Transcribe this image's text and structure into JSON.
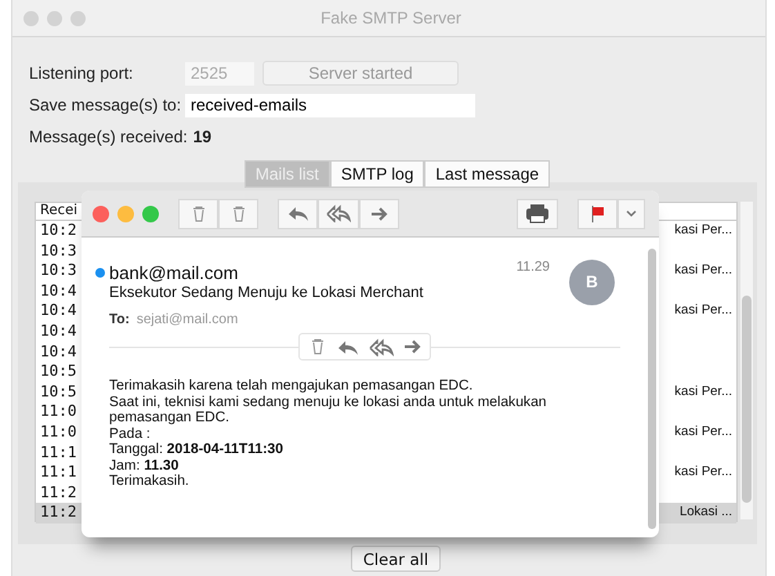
{
  "window": {
    "title": "Fake SMTP Server"
  },
  "form": {
    "port_label": "Listening port:",
    "port_value": "2525",
    "server_button": {
      "label": "Server started",
      "disabled": true
    },
    "save_label": "Save message(s) to:",
    "save_value": "received-emails",
    "received_label": "Message(s) received:",
    "received_count": "19"
  },
  "tabs": [
    {
      "label": "Mails list",
      "selected": true
    },
    {
      "label": "SMTP log",
      "selected": false
    },
    {
      "label": "Last message",
      "selected": false
    }
  ],
  "table": {
    "header": "Recei",
    "rows": [
      {
        "time": "10:2",
        "subject": "kasi Per...",
        "selected": false
      },
      {
        "time": "10:3",
        "selected": false
      },
      {
        "time": "10:3",
        "subject": "kasi Per...",
        "selected": false
      },
      {
        "time": "10:4",
        "selected": false
      },
      {
        "time": "10:4",
        "subject": "kasi Per...",
        "selected": false
      },
      {
        "time": "10:4",
        "selected": false
      },
      {
        "time": "10:4",
        "selected": false
      },
      {
        "time": "10:5",
        "selected": false
      },
      {
        "time": "10:5",
        "subject": "kasi Per...",
        "selected": false
      },
      {
        "time": "11:0",
        "selected": false
      },
      {
        "time": "11:0",
        "subject": "kasi Per...",
        "selected": false
      },
      {
        "time": "11:1",
        "selected": false
      },
      {
        "time": "11:1",
        "subject": "kasi Per...",
        "selected": false
      },
      {
        "time": "11:2",
        "selected": false
      },
      {
        "time": "11:2",
        "subject": "Lokasi ...",
        "selected": true
      }
    ]
  },
  "message": {
    "from": "bank@mail.com",
    "unread": true,
    "time": "11.29",
    "avatar": "B",
    "subject": "Eksekutor Sedang Menuju ke Lokasi Merchant",
    "to_label": "To:",
    "to": "sejati@mail.com",
    "flagged": true,
    "body": [
      "Terimakasih karena telah mengajukan pemasangan EDC.",
      "Saat ini, teknisi kami sedang menuju ke lokasi anda untuk melakukan",
      "pemasangan EDC.",
      "Pada :",
      "Tanggal: **2018-04-11T11:30**",
      "Jam: **11.30**",
      "Terimakasih."
    ]
  },
  "clear_button": "Clear all"
}
